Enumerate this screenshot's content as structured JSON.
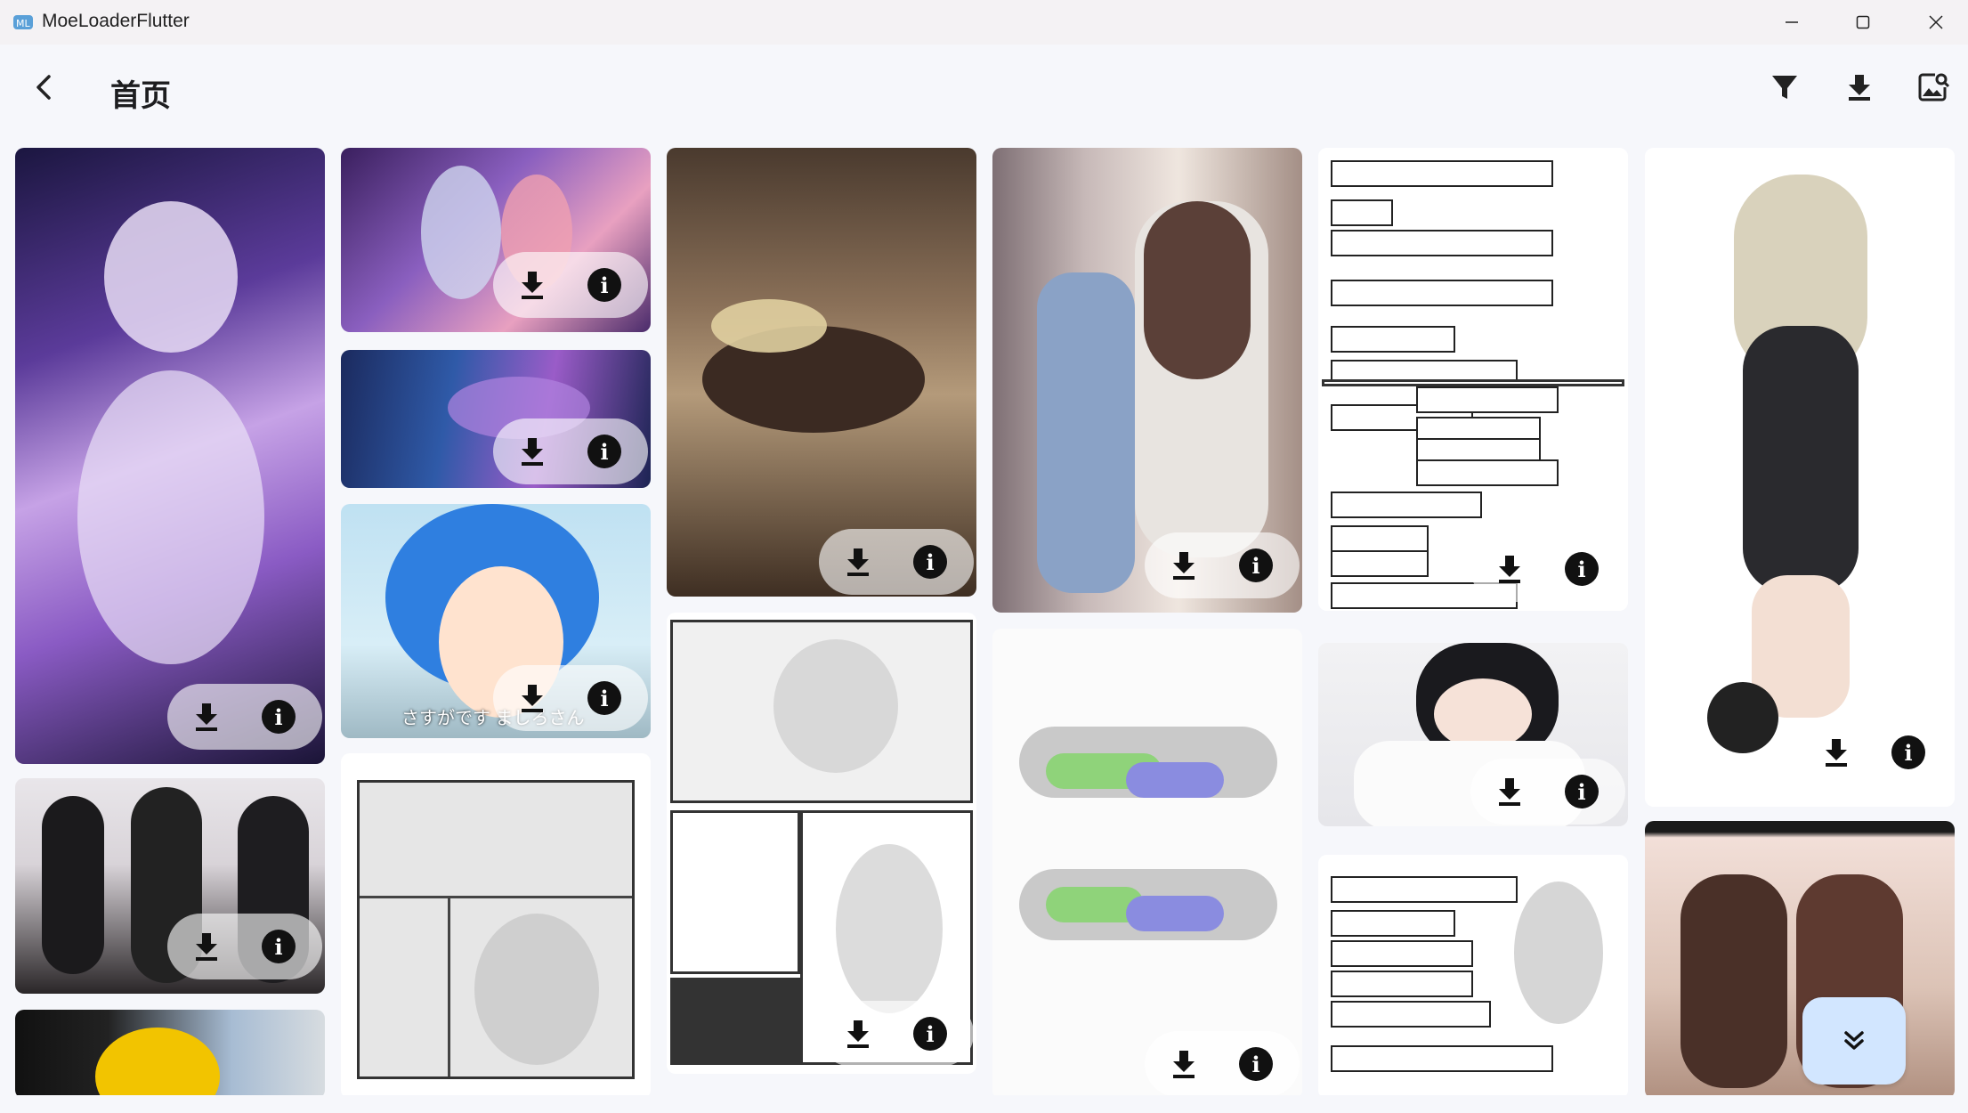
{
  "window": {
    "title": "MoeLoaderFlutter"
  },
  "appbar": {
    "title": "首页"
  },
  "icons": {
    "app": "app-logo-icon",
    "minimize": "minimize-icon",
    "maximize": "maximize-icon",
    "close": "close-icon",
    "back": "back-arrow-icon",
    "filter": "filter-icon",
    "downloads": "download-icon",
    "save": "save-image-icon",
    "card_download": "download-icon",
    "card_info": "info-icon",
    "scroll_down": "double-chevron-down-icon"
  },
  "cards": {
    "info_glyph": "i",
    "c7_caption": "さすがです ましろさん"
  },
  "colors": {
    "fab": "#d2e6ff",
    "background": "#f6f7fb"
  }
}
